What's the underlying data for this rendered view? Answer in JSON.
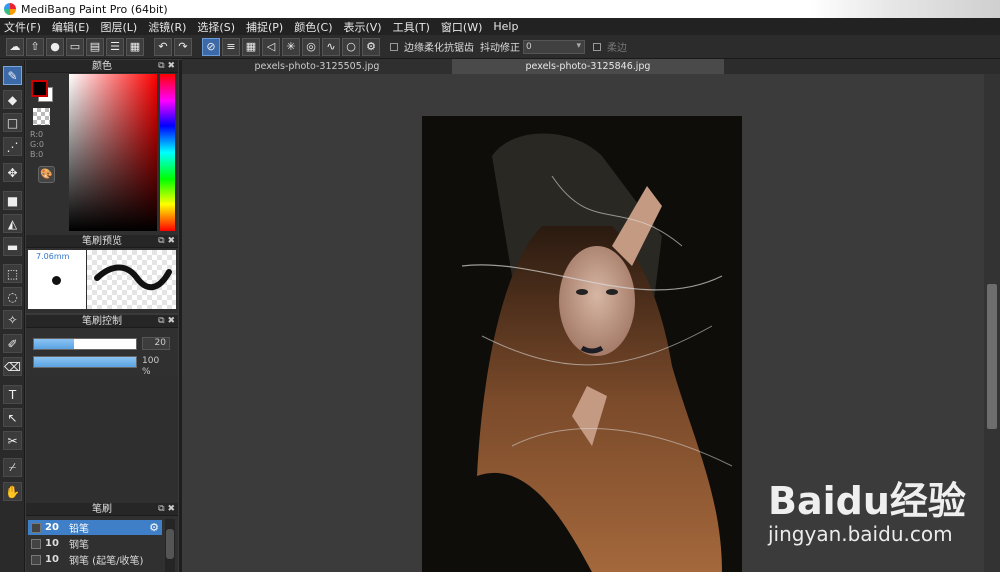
{
  "window": {
    "title": "MediBang Paint Pro (64bit)"
  },
  "menu": [
    "文件(F)",
    "编辑(E)",
    "图层(L)",
    "滤镜(R)",
    "选择(S)",
    "捕捉(P)",
    "颜色(C)",
    "表示(V)",
    "工具(T)",
    "窗口(W)",
    "Help"
  ],
  "toolbar": {
    "antialias_label": "边缘柔化抗锯齿",
    "stabilizer_label": "抖动修正",
    "stabilizer_value": "0",
    "soft_edge_label": "柔边"
  },
  "tabs": [
    {
      "label": "pexels-photo-3125505.jpg",
      "active": false
    },
    {
      "label": "pexels-photo-3125846.jpg",
      "active": true
    }
  ],
  "color_panel": {
    "title": "颜色",
    "r": "R:0",
    "g": "G:0",
    "b": "B:0",
    "fg_color": "#000000",
    "bg_color": "#ffffff"
  },
  "brush_preview": {
    "title": "笔刷预览",
    "size": "7.06mm"
  },
  "brush_control": {
    "title": "笔刷控制",
    "size_value": "20",
    "size_fraction": 0.39,
    "opacity_value": "100 %",
    "opacity_fraction": 1.0
  },
  "brush_list": {
    "title": "笔刷",
    "items": [
      {
        "size": "20",
        "name": "铅笔",
        "selected": true
      },
      {
        "size": "10",
        "name": "钢笔",
        "selected": false
      },
      {
        "size": "10",
        "name": "钢笔 (起笔/收笔)",
        "selected": false
      }
    ]
  },
  "watermark": {
    "brand": "Baidu经验",
    "site": "jingyan.baidu.com"
  },
  "colors": {
    "accent": "#3c6aa8",
    "selection": "#3f7fc8"
  }
}
